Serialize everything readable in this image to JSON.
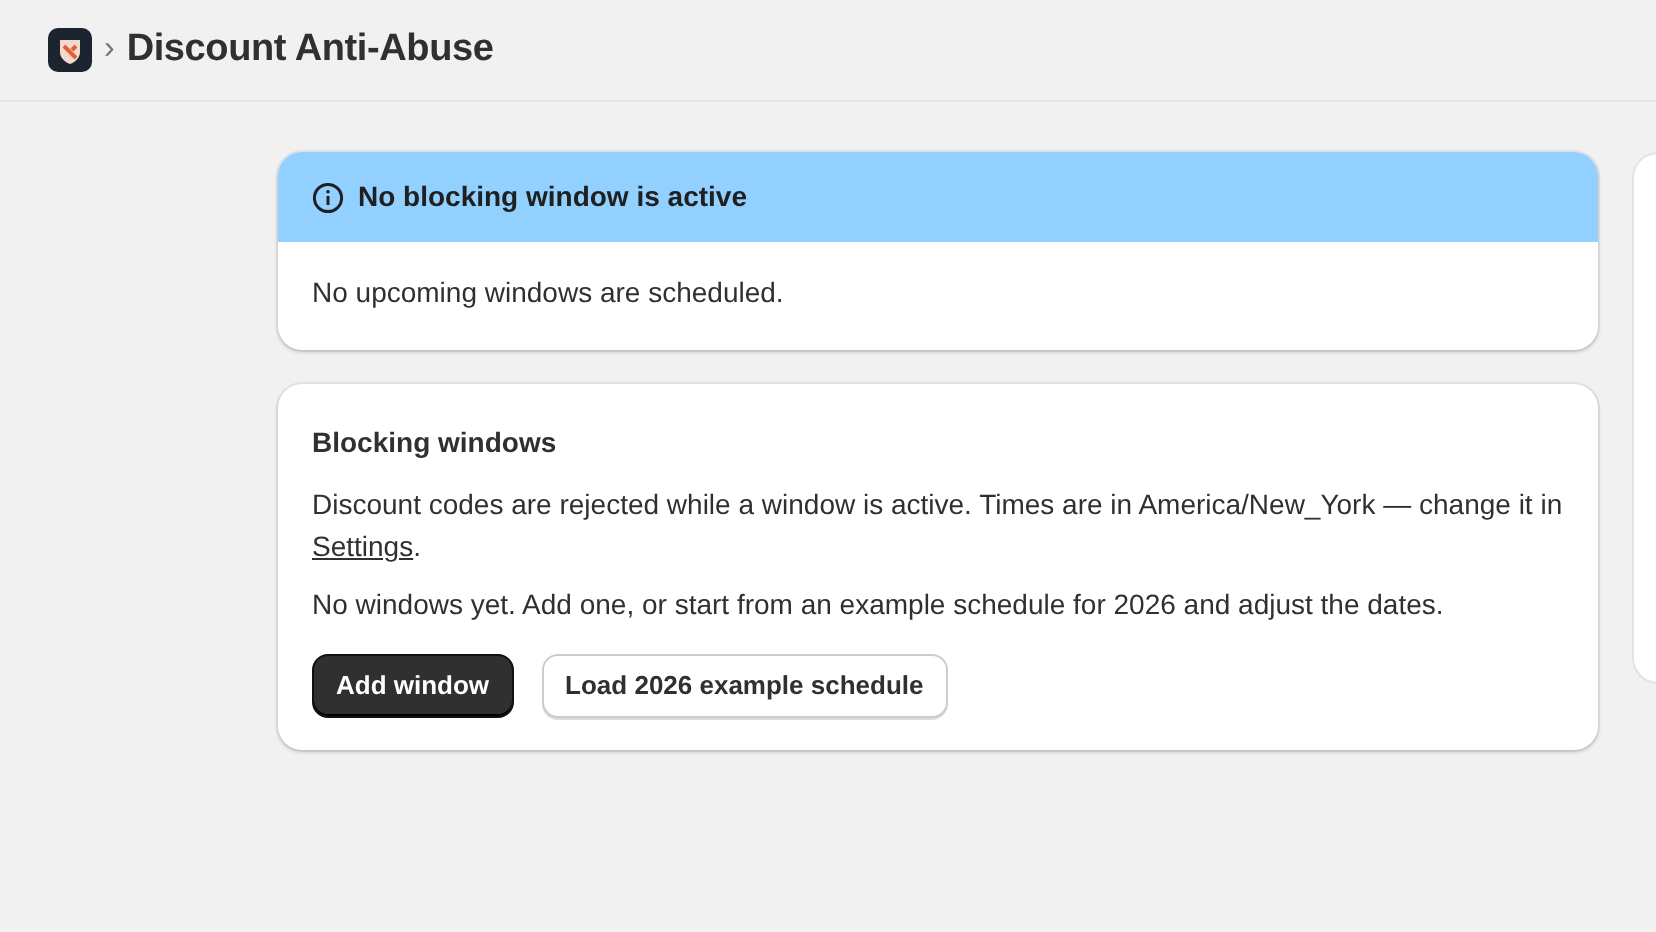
{
  "header": {
    "title": "Discount Anti-Abuse",
    "separator": "›"
  },
  "status_banner": {
    "title": "No blocking window is active",
    "body": "No upcoming windows are scheduled."
  },
  "blocking_windows": {
    "title": "Blocking windows",
    "description": {
      "text_before": "Discount codes are rejected while a window is active. Times are in America/New_York — change it in ",
      "link": "Settings",
      "text_after": "."
    },
    "empty_message": "No windows yet. Add one, or start from an example schedule for 2026 and adjust the dates.",
    "buttons": [
      {
        "label": "Add window",
        "kind": "primary"
      },
      {
        "label": "Load 2026 example schedule",
        "kind": "secondary"
      }
    ]
  }
}
